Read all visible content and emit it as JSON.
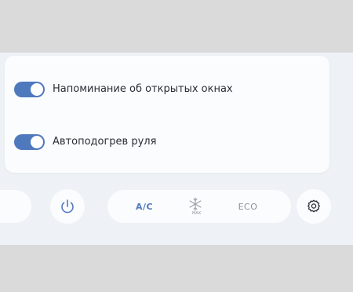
{
  "settings": {
    "items": [
      {
        "label": "Напоминание об открытых окнах",
        "enabled": true,
        "icon": "toggle-switch"
      },
      {
        "label": "Автоподогрев руля",
        "enabled": true,
        "icon": "toggle-switch"
      }
    ]
  },
  "bottom_bar": {
    "power_icon": "power-icon",
    "climate": {
      "ac_label": "A/C",
      "max_label": "MAX",
      "max_icon": "snowflake-icon",
      "eco_label": "ECO"
    },
    "settings_icon": "gear-icon"
  },
  "colors": {
    "accent": "#4f79bd",
    "background": "#eef1f6",
    "card": "#fbfcfe",
    "outer": "#dadada",
    "text": "#2a2d33",
    "muted": "#8b8f96"
  }
}
